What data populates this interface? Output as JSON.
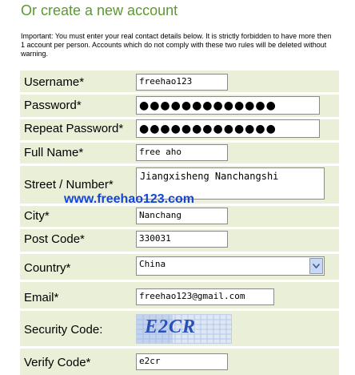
{
  "header": {
    "title": "Or create a new account"
  },
  "notice": "Important: You must enter your real contact details below. It is strictly forbidden to have more then 1 account per person. Accounts which do not comply with these two rules will be deleted without warning.",
  "form": {
    "username": {
      "label": "Username*",
      "value": "freehao123"
    },
    "password": {
      "label": "Password*",
      "value": "●●●●●●●●●●●●●"
    },
    "repeat_password": {
      "label": "Repeat Password*",
      "value": "●●●●●●●●●●●●●"
    },
    "full_name": {
      "label": "Full Name*",
      "value": "free aho"
    },
    "street": {
      "label": "Street / Number*",
      "value": "Jiangxisheng Nanchangshi"
    },
    "city": {
      "label": "City*",
      "value": "Nanchang"
    },
    "post_code": {
      "label": "Post Code*",
      "value": "330031"
    },
    "country": {
      "label": "Country*",
      "value": "China"
    },
    "email": {
      "label": "Email*",
      "value": "freehao123@gmail.com"
    },
    "security_code": {
      "label": "Security Code:",
      "captcha_text": "E2CR"
    },
    "verify_code": {
      "label": "Verify Code*",
      "value": "e2cr"
    }
  },
  "watermark": "www.freehao123.com",
  "colors": {
    "title": "#5a9a2e",
    "table_bg": "#eaf0d8",
    "watermark": "#1444d8"
  }
}
